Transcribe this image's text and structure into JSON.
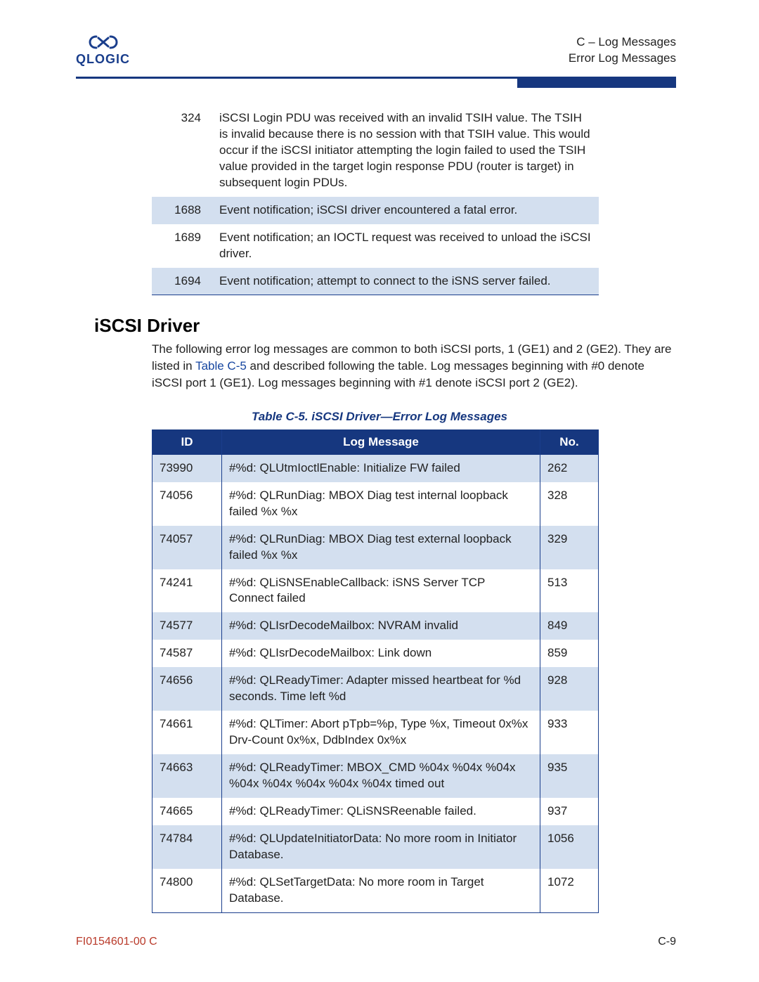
{
  "header": {
    "logo_text": "QLOGIC",
    "right_line1": "C – Log Messages",
    "right_line2": "Error Log Messages"
  },
  "mini_rows": [
    {
      "id": "324",
      "msg": "iSCSI Login PDU was received with an invalid TSIH value. The TSIH is invalid because there is no session with that TSIH value. This would occur if the iSCSI initiator attempting the login failed to used the TSIH value provided in the target login response PDU (router is target) in subsequent login PDUs.",
      "shade": false
    },
    {
      "id": "1688",
      "msg": "Event notification; iSCSI driver encountered a fatal error.",
      "shade": true
    },
    {
      "id": "1689",
      "msg": "Event notification; an IOCTL request was received to unload the iSCSI driver.",
      "shade": false
    },
    {
      "id": "1694",
      "msg": "Event notification; attempt to connect to the iSNS server failed.",
      "shade": true
    }
  ],
  "section_title": "iSCSI Driver",
  "paragraph_pre": "The following error log messages are common to both iSCSI ports, 1 (GE1) and 2 (GE2). They are listed in ",
  "paragraph_link": "Table C-5",
  "paragraph_post": " and described following the table. Log messages beginning with #0 denote iSCSI port 1 (GE1). Log messages beginning with #1 denote iSCSI port 2 (GE2).",
  "table_caption": "Table C-5. iSCSI Driver—Error Log Messages",
  "columns": {
    "id": "ID",
    "msg": "Log Message",
    "no": "No."
  },
  "rows": [
    {
      "id": "73990",
      "msg": "#%d: QLUtmIoctlEnable: Initialize FW failed",
      "no": "262",
      "shade": true
    },
    {
      "id": "74056",
      "msg": "#%d: QLRunDiag: MBOX Diag test internal loopback failed %x %x",
      "no": "328",
      "shade": false
    },
    {
      "id": "74057",
      "msg": "#%d: QLRunDiag: MBOX Diag test external loopback failed %x %x",
      "no": "329",
      "shade": true
    },
    {
      "id": "74241",
      "msg": "#%d: QLiSNSEnableCallback: iSNS Server TCP Connect failed",
      "no": "513",
      "shade": false
    },
    {
      "id": "74577",
      "msg": "#%d: QLIsrDecodeMailbox: NVRAM invalid",
      "no": "849",
      "shade": true
    },
    {
      "id": "74587",
      "msg": "#%d: QLIsrDecodeMailbox: Link down",
      "no": "859",
      "shade": false
    },
    {
      "id": "74656",
      "msg": "#%d: QLReadyTimer: Adapter missed heartbeat for %d seconds. Time left %d",
      "no": "928",
      "shade": true
    },
    {
      "id": "74661",
      "msg": "#%d: QLTimer: Abort pTpb=%p, Type %x, Timeout 0x%x Drv-Count 0x%x, DdbIndex 0x%x",
      "no": "933",
      "shade": false
    },
    {
      "id": "74663",
      "msg": "#%d: QLReadyTimer: MBOX_CMD %04x %04x %04x %04x %04x %04x %04x %04x timed out",
      "no": "935",
      "shade": true
    },
    {
      "id": "74665",
      "msg": "#%d: QLReadyTimer: QLiSNSReenable failed.",
      "no": "937",
      "shade": false
    },
    {
      "id": "74784",
      "msg": "#%d: QLUpdateInitiatorData: No more room in Initiator Database.",
      "no": "1056",
      "shade": true
    },
    {
      "id": "74800",
      "msg": "#%d: QLSetTargetData: No more room in Target Database.",
      "no": "1072",
      "shade": false
    }
  ],
  "footer": {
    "docnum": "FI0154601-00  C",
    "pageno": "C-9"
  }
}
